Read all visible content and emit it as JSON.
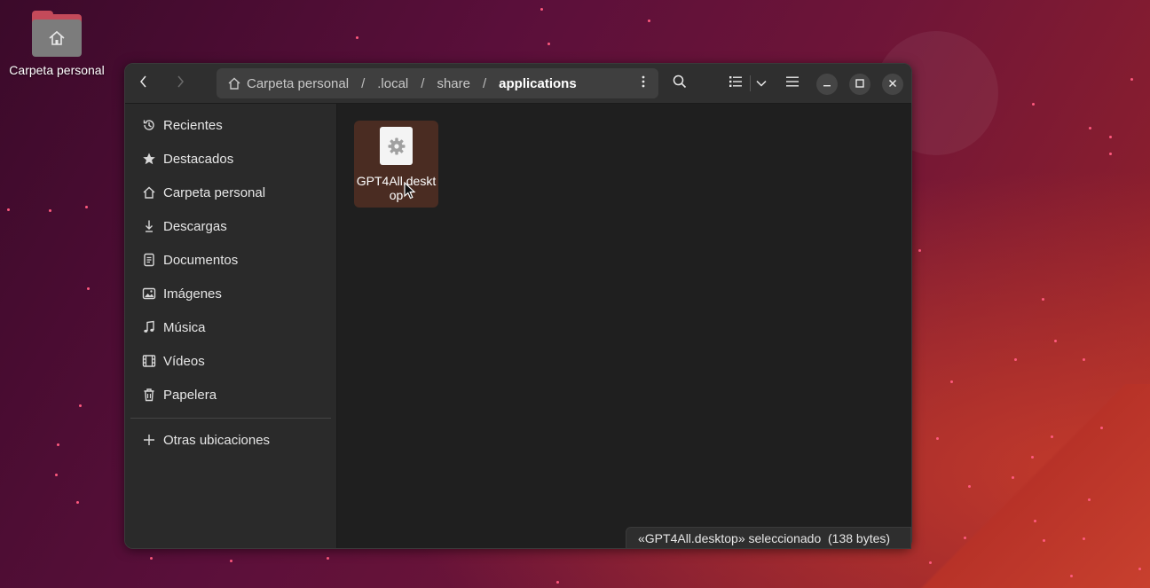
{
  "desktop": {
    "home_label": "Carpeta personal"
  },
  "pathbar": {
    "crumbs": [
      "Carpeta personal",
      ".local",
      "share",
      "applications"
    ],
    "separator": "/"
  },
  "sidebar": {
    "items": [
      {
        "label": "Recientes",
        "icon": "clock-icon"
      },
      {
        "label": "Destacados",
        "icon": "star-icon"
      },
      {
        "label": "Carpeta personal",
        "icon": "home-icon"
      },
      {
        "label": "Descargas",
        "icon": "download-icon"
      },
      {
        "label": "Documentos",
        "icon": "document-icon"
      },
      {
        "label": "Imágenes",
        "icon": "image-icon"
      },
      {
        "label": "Música",
        "icon": "music-icon"
      },
      {
        "label": "Vídeos",
        "icon": "video-icon"
      },
      {
        "label": "Papelera",
        "icon": "trash-icon"
      }
    ],
    "other_locations": "Otras ubicaciones"
  },
  "files": [
    {
      "name": "GPT4All.desktop",
      "icon": "gear-icon",
      "selected": true
    }
  ],
  "status": {
    "text": "«GPT4All.desktop» seleccionado  (138 bytes)"
  },
  "colors": {
    "selection": "#4a2c22",
    "window_bg": "#242424",
    "sidebar_bg": "#2a2a2a"
  }
}
